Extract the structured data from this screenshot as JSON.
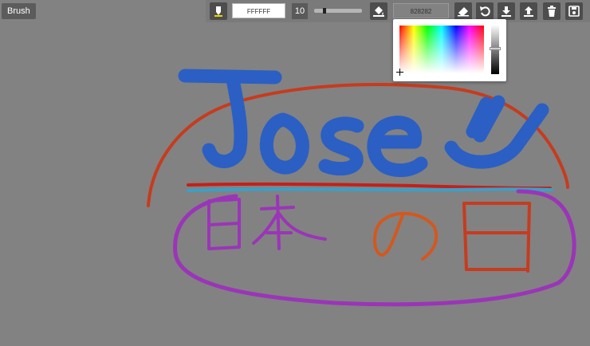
{
  "mode_label": "Brush",
  "brush_color": "FFFFFF",
  "brush_size": "10",
  "brush_size_slider": 0.2,
  "fill_color": "828282",
  "canvas_background": "#828282",
  "stroke_colors": {
    "red": "#c73b1e",
    "blue": "#2b5fc4",
    "purple": "#9b35b8",
    "orange": "#d3581e",
    "light_blue": "#3aa0c8"
  },
  "picker": {
    "lightness_handle": 0.49
  },
  "toolbar": {
    "pen_icon": "pen-icon",
    "fill_icon": "paint-bucket-icon",
    "eraser_icon": "eraser-icon",
    "undo_icon": "undo-icon",
    "download_icon": "download-icon",
    "upload_icon": "upload-icon",
    "trash_icon": "trash-icon",
    "save_icon": "save-icon"
  }
}
